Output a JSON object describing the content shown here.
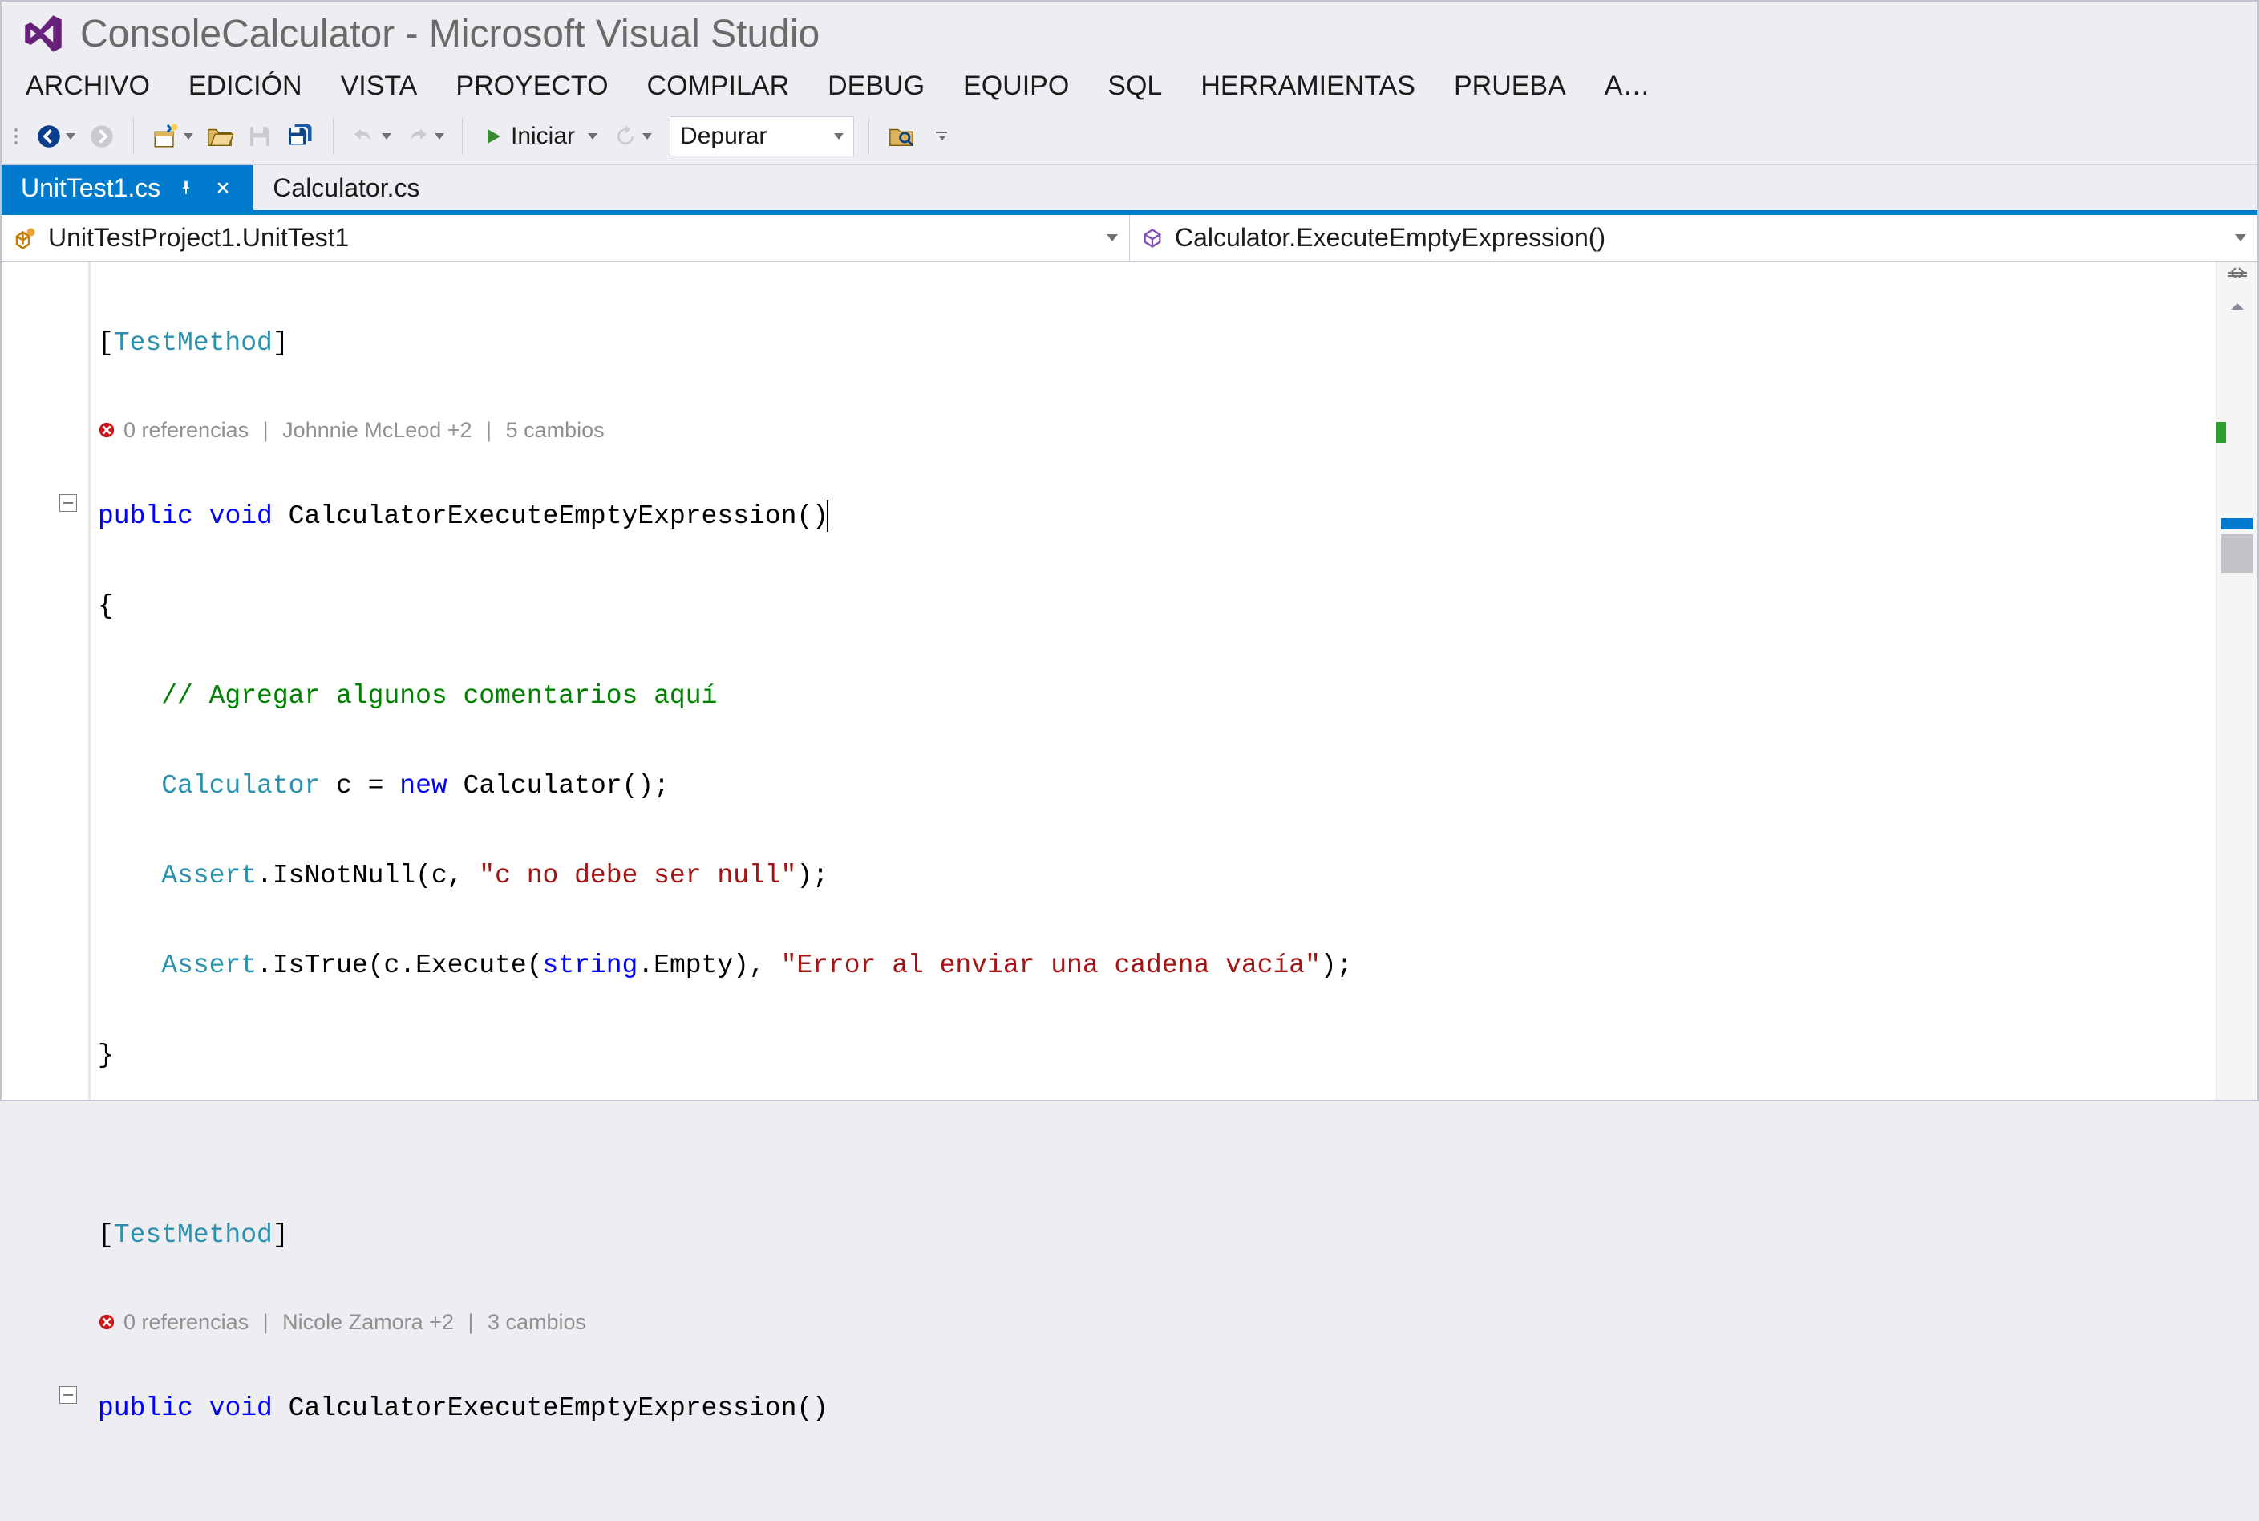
{
  "title": "ConsoleCalculator - Microsoft Visual Studio",
  "menu": [
    "ARCHIVO",
    "EDICIÓN",
    "VISTA",
    "PROYECTO",
    "COMPILAR",
    "DEBUG",
    "EQUIPO",
    "SQL",
    "HERRAMIENTAS",
    "PRUEBA",
    "A…"
  ],
  "toolbar": {
    "start_label": "Iniciar",
    "config_label": "Depurar"
  },
  "tabs": {
    "active": "UnitTest1.cs",
    "inactive": "Calculator.cs"
  },
  "nav": {
    "left": "UnitTestProject1.UnitTest1",
    "right": "Calculator.ExecuteEmptyExpression()"
  },
  "codelens1": {
    "refs": "0 referencias",
    "author": "Johnnie McLeod +2",
    "changes": "5 cambios"
  },
  "codelens2": {
    "refs": "0 referencias",
    "author": "Nicole Zamora +2",
    "changes": "3 cambios"
  },
  "code": {
    "attr1": "TestMethod",
    "sig1_public": "public",
    "sig1_void": "void",
    "sig1_name": " CalculatorExecuteEmptyExpression()",
    "brace_open": "{",
    "comment": "// Agregar algunos comentarios aquí",
    "type_calc": "Calculator",
    "var_c": " c = ",
    "kw_new": "new",
    "ctor": " Calculator();",
    "assert1_a": "Assert",
    "assert1_b": ".IsNotNull(c, ",
    "assert1_str": "\"c no debe ser null\"",
    "assert1_c": ");",
    "assert2_a": "Assert",
    "assert2_b": ".IsTrue(c.Execute(",
    "assert2_kw": "string",
    "assert2_c": ".Empty), ",
    "assert2_str": "\"Error al enviar una cadena vacía\"",
    "assert2_d": ");",
    "brace_close": "}",
    "attr2": "TestMethod",
    "sig2_public": "public",
    "sig2_void": "void",
    "sig2_name": " CalculatorExecuteEmptyExpression()"
  }
}
